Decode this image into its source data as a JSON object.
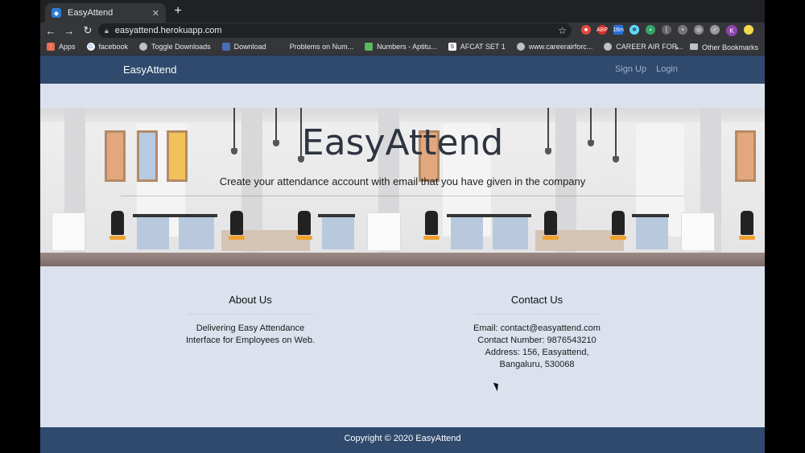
{
  "browser": {
    "tab_title": "EasyAttend",
    "tab_close": "✕",
    "new_tab": "+",
    "nav": {
      "back": "←",
      "forward": "→",
      "reload": "↻"
    },
    "url": "easyattend.herokuapp.com",
    "extensions": [
      "ABP",
      "16m"
    ],
    "profile_initial": "K",
    "bookmarks": [
      {
        "label": "Apps",
        "icon": "apps-grid-icon",
        "color": "#e86c4e"
      },
      {
        "label": "facebook",
        "icon": "google-icon",
        "color": "#e8eaed"
      },
      {
        "label": "Toggle Downloads",
        "icon": "globe-icon",
        "color": "#bdc1c6"
      },
      {
        "label": "Download",
        "icon": "download-icon",
        "color": "#4b6cb7"
      },
      {
        "label": "Problems on Num...",
        "icon": "blank-icon",
        "color": "#35363a"
      },
      {
        "label": "Numbers - Aptitu...",
        "icon": "leaf-icon",
        "color": "#5cb85c"
      },
      {
        "label": "AFCAT SET 1",
        "icon": "s-icon",
        "color": "#ffffff"
      },
      {
        "label": "www.careerairforc...",
        "icon": "globe-icon",
        "color": "#bdc1c6"
      },
      {
        "label": "CAREER AIR FOR...",
        "icon": "globe-icon",
        "color": "#bdc1c6"
      }
    ],
    "more": "»",
    "other_bookmarks": "Other Bookmarks"
  },
  "site": {
    "brand": "EasyAttend",
    "nav_links": {
      "signup": "Sign Up",
      "login": "Login"
    },
    "hero": {
      "title": "EasyAttend",
      "subtitle": "Create your attendance account with email that you have given in the company"
    },
    "about": {
      "heading": "About Us",
      "text": "Delivering Easy Attendance Interface for Employees on Web."
    },
    "contact": {
      "heading": "Contact Us",
      "email": "Email: contact@easyattend.com",
      "phone": "Contact Number: 9876543210",
      "address": "Address: 156, Easyattend, Bangaluru, 530068"
    },
    "footer": "Copyright © 2020 EasyAttend"
  },
  "colors": {
    "navbar": "#2f4a6d",
    "page_bg": "#dbe2ee",
    "chair_seat": "#f0a12f"
  }
}
